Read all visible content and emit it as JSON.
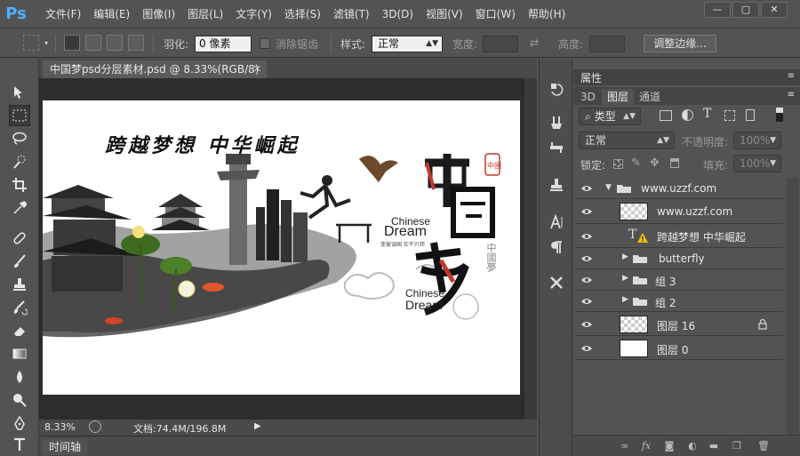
{
  "app": {
    "logo": "Ps",
    "menus": [
      "文件(F)",
      "编辑(E)",
      "图像(I)",
      "图层(L)",
      "文字(Y)",
      "选择(S)",
      "滤镜(T)",
      "3D(D)",
      "视图(V)",
      "窗口(W)",
      "帮助(H)"
    ],
    "window_controls": {
      "minimize": "—",
      "maximize": "▢",
      "close": "✕"
    }
  },
  "options_bar": {
    "feather_label": "羽化:",
    "feather_value": "0 像素",
    "antialias_label": "消除锯齿",
    "style_label": "样式:",
    "style_value": "正常",
    "width_label": "宽度:",
    "height_label": "高度:",
    "refine_edge_button": "调整边缘..."
  },
  "document": {
    "tab_title": "中国梦psd分层素材.psd @ 8.33%(RGB/8)",
    "tab_close": "✕",
    "zoom": "8.33%",
    "doc_info": "文档:74.4M/196.8M",
    "artwork": {
      "headline": "跨越梦想 中华崛起",
      "chinese_small": "Chinese",
      "dream_small": "Dream",
      "dream_sub": "变彼误国 实干兴邦",
      "chinese_large": "Chinese",
      "dream_large": "Dream",
      "big_title": "中國夢"
    }
  },
  "timeline": {
    "label": "时间轴"
  },
  "panel": {
    "header": "属性",
    "tabs": [
      "3D",
      "图层",
      "通道"
    ],
    "active_tab": "图层",
    "filter_label": "类型",
    "blend_mode": "正常",
    "opacity_label": "不透明度:",
    "opacity_value": "100%",
    "lock_label": "锁定:",
    "fill_label": "填充:",
    "fill_value": "100%",
    "layers": [
      {
        "name": "www.uzzf.com",
        "kind": "group-open",
        "indent": 0
      },
      {
        "name": "www.uzzf.com",
        "kind": "pixel",
        "indent": 1
      },
      {
        "name": "跨越梦想 中华崛起",
        "kind": "text-warning",
        "indent": 1
      },
      {
        "name": "butterfly",
        "kind": "group",
        "indent": 1
      },
      {
        "name": "组 3",
        "kind": "group",
        "indent": 1
      },
      {
        "name": "组 2",
        "kind": "group",
        "indent": 1
      },
      {
        "name": "图层 16",
        "kind": "pixel-locked",
        "indent": 0
      },
      {
        "name": "图层 0",
        "kind": "white",
        "indent": 0
      }
    ]
  },
  "colors": {
    "ui_bg": "#535353",
    "canvas_bg": "#2d2d2d",
    "ps_blue": "#4fb0ff",
    "seal_red": "#c0392b"
  }
}
